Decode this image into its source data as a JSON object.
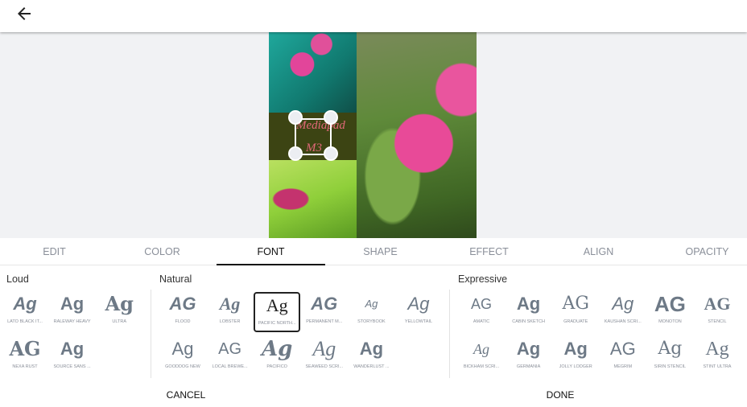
{
  "header": {
    "back_icon": "arrow-left-icon"
  },
  "canvas": {
    "overlay_text_line1": "Mediapad",
    "overlay_text_line2": "M3"
  },
  "tabs": [
    {
      "label": "EDIT"
    },
    {
      "label": "COLOR"
    },
    {
      "label": "FONT",
      "active": true
    },
    {
      "label": "SHAPE"
    },
    {
      "label": "EFFECT"
    },
    {
      "label": "ALIGN"
    },
    {
      "label": "OPACITY"
    }
  ],
  "sections": [
    {
      "title": "Loud",
      "fonts": [
        {
          "glyph": "Ag",
          "label": "LATO BLACK IT..."
        },
        {
          "glyph": "Ag",
          "label": "RALEWAY HEAVY"
        },
        {
          "glyph": "Ag",
          "label": "ULTRA"
        },
        {
          "glyph": "AG",
          "label": "NEXA RUST"
        },
        {
          "glyph": "Ag",
          "label": "SOURCE SANS ..."
        }
      ]
    },
    {
      "title": "Natural",
      "fonts": [
        {
          "glyph": "AG",
          "label": "FLOOD"
        },
        {
          "glyph": "Ag",
          "label": "LOBSTER"
        },
        {
          "glyph": "Ag",
          "label": "PACIFIC NORTH...",
          "selected": true
        },
        {
          "glyph": "AG",
          "label": "PERMANENT M..."
        },
        {
          "glyph": "Ag",
          "label": "STORYBOOK"
        },
        {
          "glyph": "Ag",
          "label": "YELLOWTAIL"
        },
        {
          "glyph": "Ag",
          "label": "GOODDOG NEW"
        },
        {
          "glyph": "AG",
          "label": "LOCAL BREWE..."
        },
        {
          "glyph": "Ag",
          "label": "PACIFICO"
        },
        {
          "glyph": "Ag",
          "label": "SEAWEED SCRI..."
        },
        {
          "glyph": "Ag",
          "label": "WANDERLUST ..."
        }
      ]
    },
    {
      "title": "Expressive",
      "fonts": [
        {
          "glyph": "AG",
          "label": "AMATIC"
        },
        {
          "glyph": "Ag",
          "label": "CABIN SKETCH"
        },
        {
          "glyph": "AG",
          "label": "GRADUATE"
        },
        {
          "glyph": "Ag",
          "label": "KAUSHAN SCRI..."
        },
        {
          "glyph": "AG",
          "label": "MONOTON"
        },
        {
          "glyph": "AG",
          "label": "STENCIL"
        },
        {
          "glyph": "Ag",
          "label": "BICKHAM SCRI..."
        },
        {
          "glyph": "Ag",
          "label": "GERMANIA"
        },
        {
          "glyph": "Ag",
          "label": "JOLLY LODGER"
        },
        {
          "glyph": "AG",
          "label": "MEGRIM"
        },
        {
          "glyph": "Ag",
          "label": "SIRIN STENCIL"
        },
        {
          "glyph": "Ag",
          "label": "STINT ULTRA"
        }
      ]
    }
  ],
  "footer": {
    "cancel_label": "CANCEL",
    "done_label": "DONE"
  }
}
